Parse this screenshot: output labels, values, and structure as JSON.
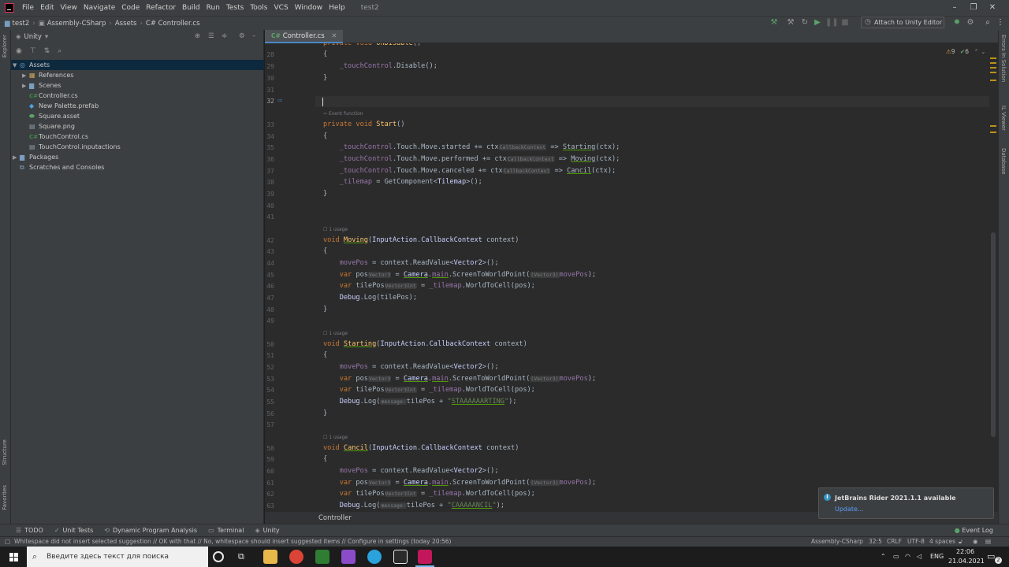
{
  "menubar": {
    "items": [
      "File",
      "Edit",
      "View",
      "Navigate",
      "Code",
      "Refactor",
      "Build",
      "Run",
      "Tests",
      "Tools",
      "VCS",
      "Window",
      "Help"
    ],
    "project_title": "test2"
  },
  "navbar": {
    "breadcrumbs": [
      "test2",
      "Assembly-CSharp",
      "Assets",
      "C# Controller.cs"
    ],
    "attach_label": "Attach to Unity Editor"
  },
  "explorer": {
    "title": "Unity",
    "tree": [
      {
        "label": "Assets",
        "level": 0,
        "expanded": true,
        "icon": "folder-icon"
      },
      {
        "label": "References",
        "level": 1,
        "expanded": false,
        "icon": "references-icon"
      },
      {
        "label": "Scenes",
        "level": 1,
        "expanded": false,
        "icon": "folder-icon"
      },
      {
        "label": "Controller.cs",
        "level": 1,
        "icon": "csharp-file-icon"
      },
      {
        "label": "New Palette.prefab",
        "level": 1,
        "icon": "prefab-icon"
      },
      {
        "label": "Square.asset",
        "level": 1,
        "icon": "asset-icon"
      },
      {
        "label": "Square.png",
        "level": 1,
        "icon": "image-file-icon"
      },
      {
        "label": "TouchControl.cs",
        "level": 1,
        "icon": "csharp-file-icon"
      },
      {
        "label": "TouchControl.inputactions",
        "level": 1,
        "icon": "file-icon"
      },
      {
        "label": "Packages",
        "level": 0,
        "expanded": false,
        "icon": "folder-icon"
      },
      {
        "label": "Scratches and Consoles",
        "level": 0,
        "icon": "scratches-icon"
      }
    ]
  },
  "left_stripe": {
    "explorer": "Explorer",
    "structure": "Structure",
    "favorites": "Favorites"
  },
  "right_stripe": {
    "errors": "Errors In Solution",
    "il_viewer": "IL Viewer",
    "database": "Database"
  },
  "editor": {
    "tab": "Controller.cs",
    "inspections": {
      "warnings": "9",
      "weak": "6"
    },
    "hints": {
      "event_function": "Event function",
      "usage": "1 usage"
    },
    "partial_top_line": "private void OnDisable()",
    "breadcrumb": "Controller"
  },
  "tool_tabs": [
    "TODO",
    "Unit Tests",
    "Dynamic Program Analysis",
    "Terminal",
    "Unity"
  ],
  "event_log": "Event Log",
  "statusbar": {
    "message": "Whitespace did not insert selected suggestion // OK with that // No, whitespace should insert suggested items // Configure in settings (today 20:56)",
    "context": "Assembly-CSharp",
    "position": "32:5",
    "line_ending": "CRLF",
    "encoding": "UTF-8",
    "indent": "4 spaces"
  },
  "notification": {
    "title": "JetBrains Rider 2021.1.1 available",
    "link": "Update..."
  },
  "taskbar": {
    "search_placeholder": "Введите здесь текст для поиска",
    "lang": "ENG",
    "time": "22:06",
    "date": "21.04.2021",
    "notif_count": "2"
  },
  "colors": {
    "accent": "#4a88c7",
    "keyword": "#cc7832",
    "method": "#ffc66d",
    "string": "#6a8759",
    "background": "#2b2b2b"
  }
}
